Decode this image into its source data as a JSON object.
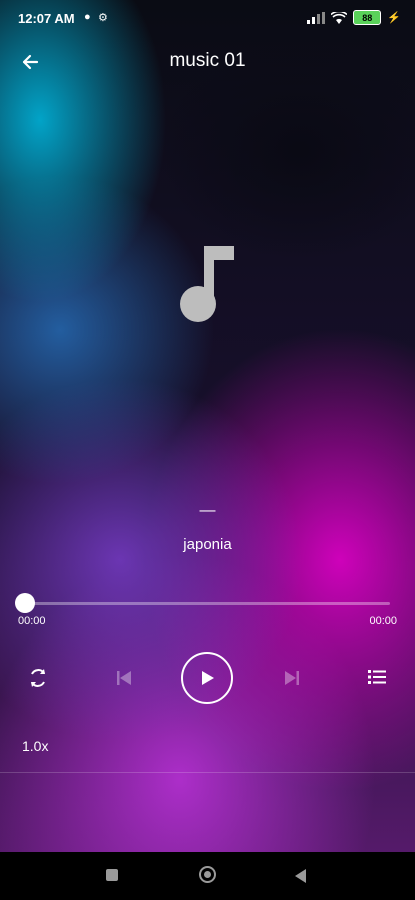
{
  "status_bar": {
    "time": "12:07 AM",
    "battery": "88"
  },
  "header": {
    "title": "music 01"
  },
  "track": {
    "title": "—",
    "artist": "japonia"
  },
  "player": {
    "current_time": "00:00",
    "total_time": "00:00",
    "progress": 0,
    "speed": "1.0x"
  },
  "colors": {
    "accent": "#ffffff",
    "battery_fill": "#5ad25a"
  },
  "icons": [
    "back-arrow-icon",
    "music-note-icon",
    "repeat-icon",
    "previous-icon",
    "play-icon",
    "next-icon",
    "playlist-icon",
    "recent-apps-icon",
    "home-icon",
    "back-icon"
  ]
}
